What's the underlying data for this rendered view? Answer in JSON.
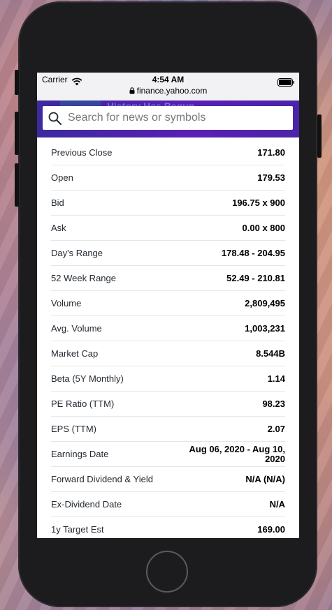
{
  "status_bar": {
    "carrier": "Carrier",
    "time": "4:54 AM",
    "url": "finance.yahoo.com"
  },
  "header": {
    "peek_text": "History Has Begun",
    "search_placeholder": "Search for news or symbols",
    "accent_color": "#4b22aa"
  },
  "quote_stats": [
    {
      "label": "Previous Close",
      "value": "171.80"
    },
    {
      "label": "Open",
      "value": "179.53"
    },
    {
      "label": "Bid",
      "value": "196.75 x 900"
    },
    {
      "label": "Ask",
      "value": "0.00 x 800"
    },
    {
      "label": "Day's Range",
      "value": "178.48 - 204.95"
    },
    {
      "label": "52 Week Range",
      "value": "52.49 - 210.81"
    },
    {
      "label": "Volume",
      "value": "2,809,495"
    },
    {
      "label": "Avg. Volume",
      "value": "1,003,231"
    },
    {
      "label": "Market Cap",
      "value": "8.544B"
    },
    {
      "label": "Beta (5Y Monthly)",
      "value": "1.14"
    },
    {
      "label": "PE Ratio (TTM)",
      "value": "98.23"
    },
    {
      "label": "EPS (TTM)",
      "value": "2.07"
    },
    {
      "label": "Earnings Date",
      "value": "Aug 06, 2020 - Aug 10, 2020"
    },
    {
      "label": "Forward Dividend & Yield",
      "value": "N/A (N/A)"
    },
    {
      "label": "Ex-Dividend Date",
      "value": "N/A"
    },
    {
      "label": "1y Target Est",
      "value": "169.00"
    }
  ]
}
